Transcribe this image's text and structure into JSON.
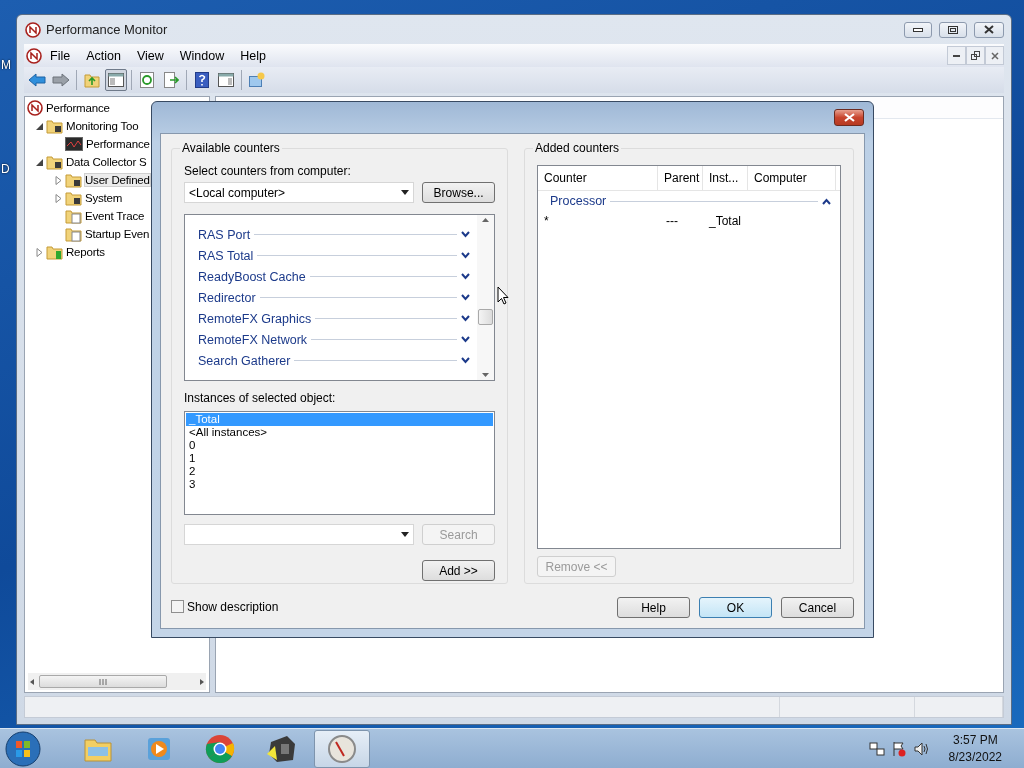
{
  "desktop": {
    "icon_labels": [
      "M",
      "D"
    ]
  },
  "window": {
    "title": "Performance Monitor"
  },
  "menu": [
    "File",
    "Action",
    "View",
    "Window",
    "Help"
  ],
  "toolbar": [
    {
      "kind": "back",
      "pressed": false
    },
    {
      "kind": "forward",
      "pressed": false
    },
    {
      "kind": "sep"
    },
    {
      "kind": "up",
      "pressed": false
    },
    {
      "kind": "tree",
      "pressed": true
    },
    {
      "kind": "sep"
    },
    {
      "kind": "refresh",
      "pressed": false
    },
    {
      "kind": "export",
      "pressed": false
    },
    {
      "kind": "sep"
    },
    {
      "kind": "help",
      "pressed": false
    },
    {
      "kind": "pane",
      "pressed": false
    },
    {
      "kind": "sep"
    },
    {
      "kind": "new",
      "pressed": false
    }
  ],
  "tree": [
    {
      "label": "Performance",
      "kind": "perfmon",
      "selected": false,
      "children": [
        {
          "label": "Monitoring Too",
          "kind": "folder",
          "expanded": true,
          "selected": false,
          "children": [
            {
              "label": "Performance",
              "kind": "chart",
              "selected": false
            }
          ]
        },
        {
          "label": "Data Collector S",
          "kind": "folder",
          "expanded": true,
          "selected": false,
          "children": [
            {
              "label": "User Defined",
              "kind": "folder",
              "expanded": false,
              "selected": true
            },
            {
              "label": "System",
              "kind": "folder",
              "expanded": false,
              "selected": false
            },
            {
              "label": "Event Trace",
              "kind": "trace",
              "selected": false
            },
            {
              "label": "Startup Even",
              "kind": "trace",
              "selected": false
            }
          ]
        },
        {
          "label": "Reports",
          "kind": "reports",
          "expanded": false,
          "selected": false
        }
      ]
    }
  ],
  "dialog": {
    "available_counters": {
      "title": "Available counters",
      "computer_label": "Select counters from computer:",
      "computer": "<Local computer>",
      "browse": "Browse...",
      "counters": [
        {
          "name": "RAS Port",
          "expanded": false
        },
        {
          "name": "RAS Total",
          "expanded": false
        },
        {
          "name": "ReadyBoost Cache",
          "expanded": false
        },
        {
          "name": "Redirector",
          "expanded": false
        },
        {
          "name": "RemoteFX Graphics",
          "expanded": false
        },
        {
          "name": "RemoteFX Network",
          "expanded": false
        },
        {
          "name": "Search Gatherer",
          "expanded": false
        }
      ],
      "instances_label": "Instances of selected object:",
      "instances": [
        {
          "label": "_Total",
          "selected": true
        },
        {
          "label": "<All instances>",
          "selected": false
        },
        {
          "label": "0",
          "selected": false
        },
        {
          "label": "1",
          "selected": false
        },
        {
          "label": "2",
          "selected": false
        },
        {
          "label": "3",
          "selected": false
        }
      ],
      "search": {
        "label": "Search",
        "disabled": true
      },
      "add": {
        "label": "Add >>",
        "disabled": false
      }
    },
    "show_description": {
      "label": "Show description",
      "checked": false
    },
    "added_counters": {
      "title": "Added counters",
      "columns": [
        "Counter",
        "Parent",
        "Inst...",
        "Computer"
      ],
      "groups": [
        {
          "name": "Processor",
          "expanded": true,
          "rows": [
            {
              "counter": "*",
              "parent": "---",
              "instance": "_Total"
            }
          ]
        }
      ],
      "remove": {
        "label": "Remove <<",
        "disabled": true
      }
    },
    "buttons": [
      {
        "label": "Help",
        "default": false
      },
      {
        "label": "OK",
        "default": true
      },
      {
        "label": "Cancel",
        "default": false
      }
    ]
  },
  "taskbar": {
    "apps": [
      {
        "kind": "explorer",
        "active": false
      },
      {
        "kind": "media",
        "active": false
      },
      {
        "kind": "chrome",
        "active": false
      },
      {
        "kind": "device",
        "active": false
      },
      {
        "kind": "perfmon",
        "active": true
      }
    ],
    "time": "3:57 PM",
    "date": "8/23/2022"
  }
}
